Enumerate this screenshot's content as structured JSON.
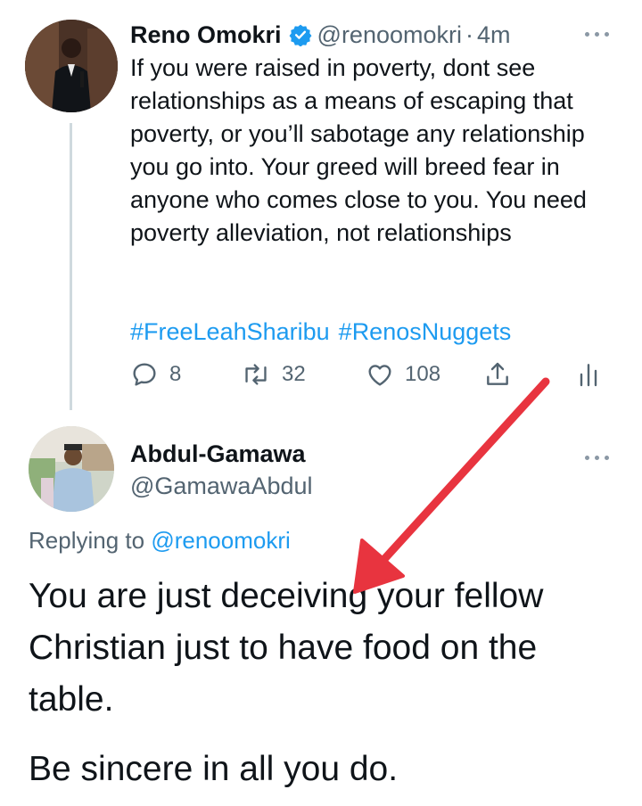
{
  "original_tweet": {
    "author_name": "Reno Omokri",
    "handle": "@renoomokri",
    "separator": "·",
    "timestamp": "4m",
    "text": "If you were raised in poverty, dont see relationships as a means of escaping that poverty, or you’ll sabotage any relationship you go into. Your greed will breed fear in anyone who comes close to you. You need poverty alleviation, not relationships",
    "hashtags": [
      "#FreeLeahSharibu",
      "#RenosNuggets"
    ],
    "actions": {
      "reply_count": "8",
      "retweet_count": "32",
      "like_count": "108"
    }
  },
  "reply_tweet": {
    "author_name": "Abdul-Gamawa",
    "handle": "@GamawaAbdul",
    "replying_label": "Replying to",
    "replying_mention": "@renoomokri",
    "text_paragraph_1": "You are just deceiving your fellow Christian just to have food on the table.",
    "text_paragraph_2": "Be sincere in all you do."
  },
  "colors": {
    "link_blue": "#1d9bf0",
    "muted_gray": "#536471",
    "verified_blue": "#1d9bf0",
    "annotation_red": "#e8343f"
  },
  "icons": [
    "verified-badge-icon",
    "more-options-icon",
    "reply-icon",
    "retweet-icon",
    "like-icon",
    "share-icon",
    "analytics-icon",
    "annotation-arrow"
  ]
}
